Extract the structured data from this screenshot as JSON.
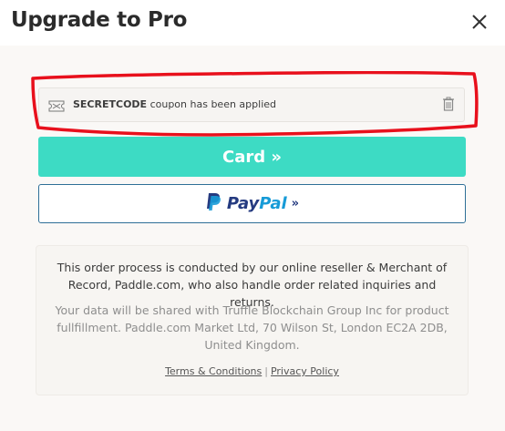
{
  "header": {
    "title": "Upgrade to Pro",
    "close_icon": "close-icon"
  },
  "coupon": {
    "code": "SECRETCODE",
    "message": " coupon has been applied",
    "ticket_icon": "ticket-icon",
    "remove_icon": "trash-icon"
  },
  "annotation": {
    "color": "#e8101c"
  },
  "payment": {
    "card_label": "Card »",
    "card_color": "#3ddbc4",
    "paypal_pay": "Pay",
    "paypal_pal": "Pal",
    "paypal_chevron": "»",
    "paypal_icon": "paypal-logo-icon"
  },
  "info": {
    "reseller_text": "This order process is conducted by our online reseller & Merchant of Record, Paddle.com, who also handle order related inquiries and returns.",
    "data_text": "Your data will be shared with Truffle Blockchain Group Inc for product fullfillment. Paddle.com Market Ltd, 70 Wilson St, London EC2A 2DB, United Kingdom.",
    "terms_label": "Terms & Conditions",
    "separator": "|",
    "privacy_label": "Privacy Policy"
  }
}
